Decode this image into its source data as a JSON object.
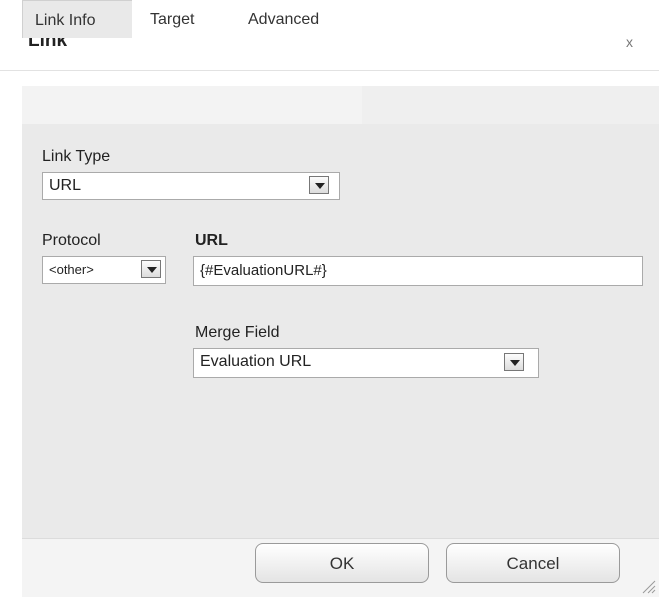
{
  "dialog": {
    "title": "Link",
    "close_glyph": "x"
  },
  "tabs": [
    {
      "label": "Link Info",
      "active": true
    },
    {
      "label": "Target",
      "active": false
    },
    {
      "label": "Advanced",
      "active": false
    }
  ],
  "link_info": {
    "link_type_label": "Link Type",
    "link_type_value": "URL",
    "protocol_label": "Protocol",
    "protocol_value": "<other>",
    "url_label": "URL",
    "url_value": "{#EvaluationURL#}",
    "merge_field_label": "Merge Field",
    "merge_field_value": "Evaluation URL"
  },
  "buttons": {
    "ok_label": "OK",
    "cancel_label": "Cancel"
  },
  "icons": {
    "close": "close-icon",
    "dropdown": "chevron-down-icon",
    "resize": "resize-grip-icon"
  }
}
